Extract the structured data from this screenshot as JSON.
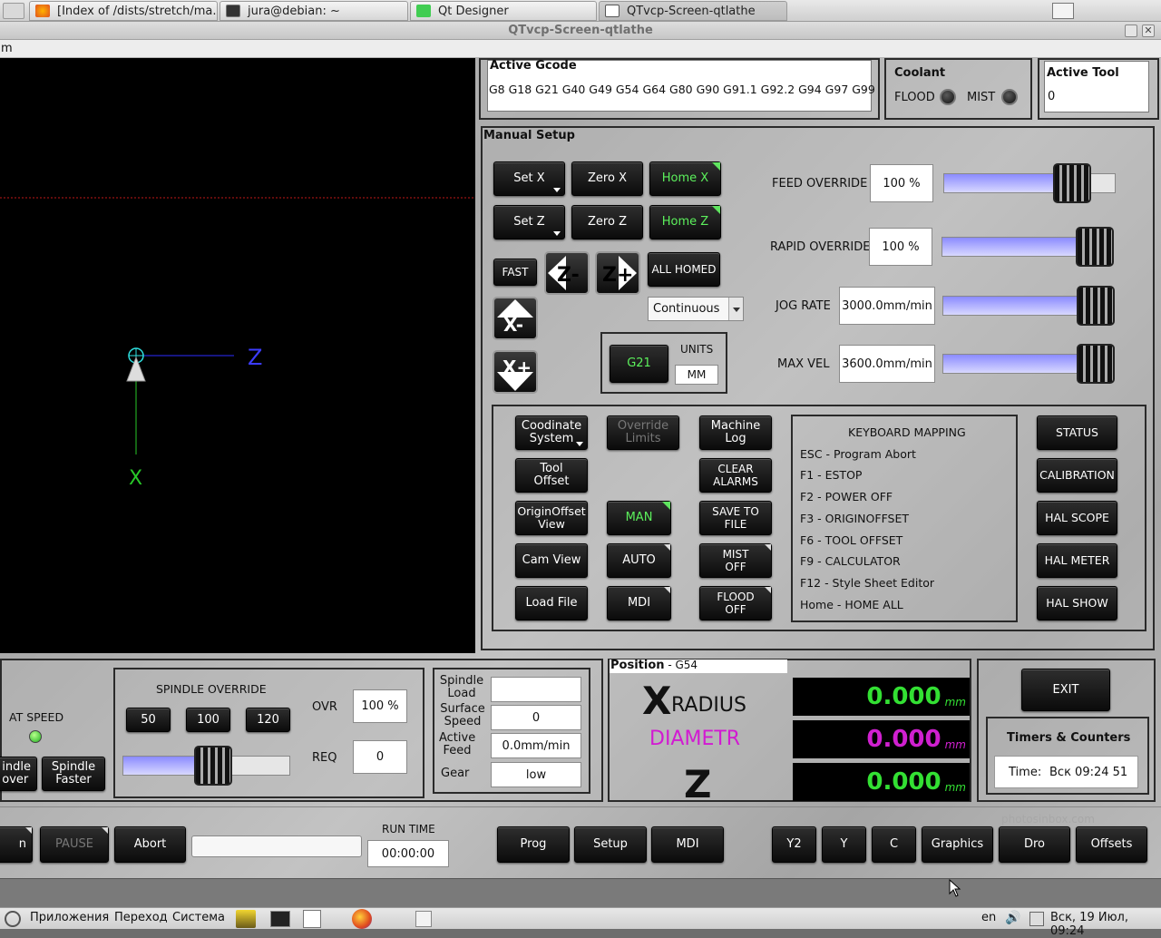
{
  "topbar": {
    "tabs": [
      {
        "label": "[Index of /dists/stretch/ma..."
      },
      {
        "label": "jura@debian: ~"
      },
      {
        "label": "Qt Designer"
      },
      {
        "label": "QTvcp-Screen-qtlathe"
      }
    ]
  },
  "window": {
    "title": "QTvcp-Screen-qtlathe",
    "menu_first": "m"
  },
  "preview": {
    "axis_z": "Z",
    "axis_x": "X"
  },
  "gcode": {
    "title": "Active Gcode",
    "codes": "G8 G18 G21 G40 G49 G54 G64 G80 G90 G91.1 G92.2 G94 G97 G99"
  },
  "coolant": {
    "title": "Coolant",
    "flood": "FLOOD",
    "mist": "MIST"
  },
  "tool": {
    "title": "Active Tool",
    "value": "0"
  },
  "manual": {
    "title": "Manual Setup",
    "set_x": "Set X",
    "zero_x": "Zero X",
    "home_x": "Home X",
    "set_z": "Set Z",
    "zero_z": "Zero Z",
    "home_z": "Home Z",
    "fast": "FAST",
    "all_homed": "ALL HOMED",
    "z_minus": "Z-",
    "z_plus": "Z+",
    "x_minus": "X-",
    "x_plus": "X+",
    "jog_mode": "Continuous",
    "g21": "G21",
    "units_label": "UNITS",
    "units_value": "MM",
    "feed_override_label": "FEED OVERRIDE",
    "feed_override_value": "100 %",
    "feed_override_level": 0.82,
    "rapid_override_label": "RAPID OVERRIDE",
    "rapid_override_value": "100 %",
    "rapid_override_level": 1.0,
    "jog_rate_label": "JOG RATE",
    "jog_rate_value": "3000.0mm/min",
    "jog_rate_level": 1.0,
    "max_vel_label": "MAX VEL",
    "max_vel_value": "3600.0mm/min",
    "max_vel_level": 1.0
  },
  "controls": {
    "coord_system": "Coodinate System",
    "override_limits": "Override Limits",
    "machine_log": "Machine Log",
    "tool_offset": "Tool Offset",
    "clear_alarms": "CLEAR ALARMS",
    "origin_offset_view": "OriginOffset View",
    "man": "MAN",
    "save_to_file": "SAVE TO FILE",
    "cam_view": "Cam View",
    "auto": "AUTO",
    "mist_off": "MIST OFF",
    "load_file": "Load File",
    "mdi": "MDI",
    "flood_off": "FLOOD OFF"
  },
  "keyboard": {
    "title": "KEYBOARD MAPPING",
    "items": [
      "ESC - Program Abort",
      "F1 - ESTOP",
      "F2 - POWER OFF",
      "F3 - ORIGINOFFSET",
      "F6 - TOOL OFFSET",
      "F9 - CALCULATOR",
      "F12 - Style Sheet Editor",
      "Home - HOME ALL"
    ]
  },
  "side_buttons": [
    "STATUS",
    "CALIBRATION",
    "HAL SCOPE",
    "HAL METER",
    "HAL SHOW"
  ],
  "spindle": {
    "at_speed": "AT SPEED",
    "slower": "indle\nover",
    "faster": "Spindle Faster",
    "override_title": "SPINDLE OVERRIDE",
    "b50": "50",
    "b100": "100",
    "b120": "120",
    "ovr_label": "OVR",
    "ovr_value": "100 %",
    "req_label": "REQ",
    "req_value": "0",
    "override_level": 0.55,
    "load_label": "Spindle Load",
    "load_value": "",
    "surface_label": "Surface Speed",
    "surface_value": "0",
    "feed_label": "Active Feed",
    "feed_value": "0.0mm/min",
    "gear_label": "Gear",
    "gear_value": "low"
  },
  "position": {
    "title": "Position",
    "wcs": " - G54",
    "x_big": "X",
    "radius": "RADIUS",
    "diametr": "DIAMETR",
    "z_big": "Z",
    "x_value": "0.000",
    "d_value": "0.000",
    "z_value": "0.000",
    "unit": "mm",
    "colors": {
      "x": "#33e033",
      "d": "#d020d0",
      "z": "#33e033"
    }
  },
  "right": {
    "exit": "EXIT",
    "timers_title": "Timers & Counters",
    "time_label": "Time:",
    "time_value": "Вск 09:24 51",
    "watermark": "photosinbox.com"
  },
  "bottom": {
    "run_cut": "n",
    "pause": "PAUSE",
    "abort": "Abort",
    "run_time_label": "RUN TIME",
    "run_time_value": "00:00:00",
    "tabs": [
      "Prog",
      "Setup",
      "MDI"
    ],
    "views": [
      "Y2",
      "Y",
      "C",
      "Graphics",
      "Dro",
      "Offsets"
    ]
  },
  "taskbar": {
    "apps": "Приложения",
    "goto": "Переход",
    "system": "Система",
    "lang": "en",
    "clock": "Вск, 19 Июл, 09:24"
  }
}
